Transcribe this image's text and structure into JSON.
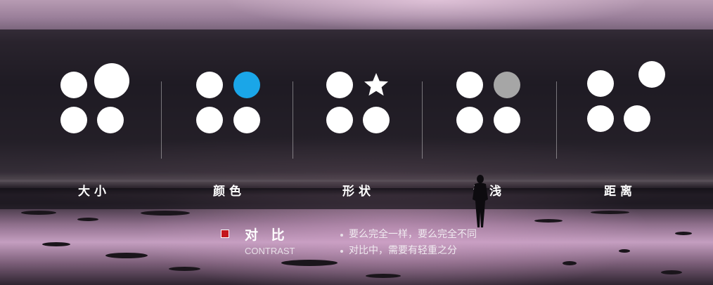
{
  "groups": [
    {
      "label": "大小"
    },
    {
      "label": "颜色"
    },
    {
      "label": "形状"
    },
    {
      "label": "深浅"
    },
    {
      "label": "距离"
    }
  ],
  "colors": {
    "white": "#ffffff",
    "accent_blue": "#1aa6e8",
    "gray": "#a6a6a6",
    "marker_red": "#c4161c"
  },
  "icons": [
    "circle",
    "star"
  ],
  "contrast": {
    "title": "对 比",
    "subtitle": "CONTRAST"
  },
  "bullets": [
    "要么完全一样，要么完全不同",
    "对比中，需要有轻重之分"
  ]
}
